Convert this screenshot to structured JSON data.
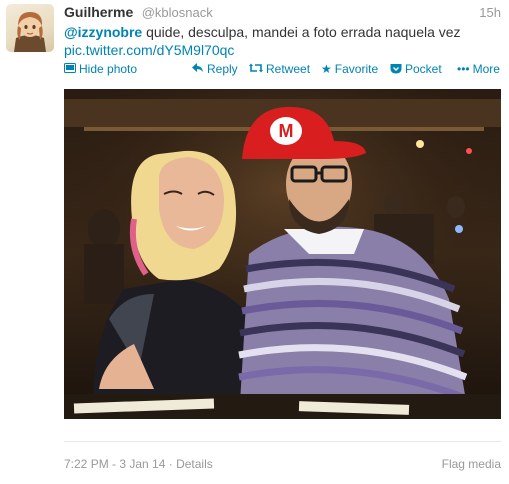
{
  "tweet": {
    "fullname": "Guilherme",
    "username": "@kblosnack",
    "time": "15h",
    "mention": "@izzynobre",
    "text": "quide, desculpa, mandei a foto errada naquela vez",
    "link": "pic.twitter.com/dY5M9l70qc"
  },
  "actions": {
    "hide_photo": "Hide photo",
    "reply": "Reply",
    "retweet": "Retweet",
    "favorite": "Favorite",
    "pocket": "Pocket",
    "more": "More"
  },
  "footer": {
    "timestamp": "7:22 PM - 3 Jan 14",
    "separator": "·",
    "details": "Details",
    "flag_media": "Flag media"
  },
  "colors": {
    "link": "#0084b4",
    "muted": "#999999",
    "text": "#333333"
  },
  "icons": [
    "photo-icon",
    "reply-icon",
    "retweet-icon",
    "star-icon",
    "pocket-icon",
    "more-icon"
  ]
}
